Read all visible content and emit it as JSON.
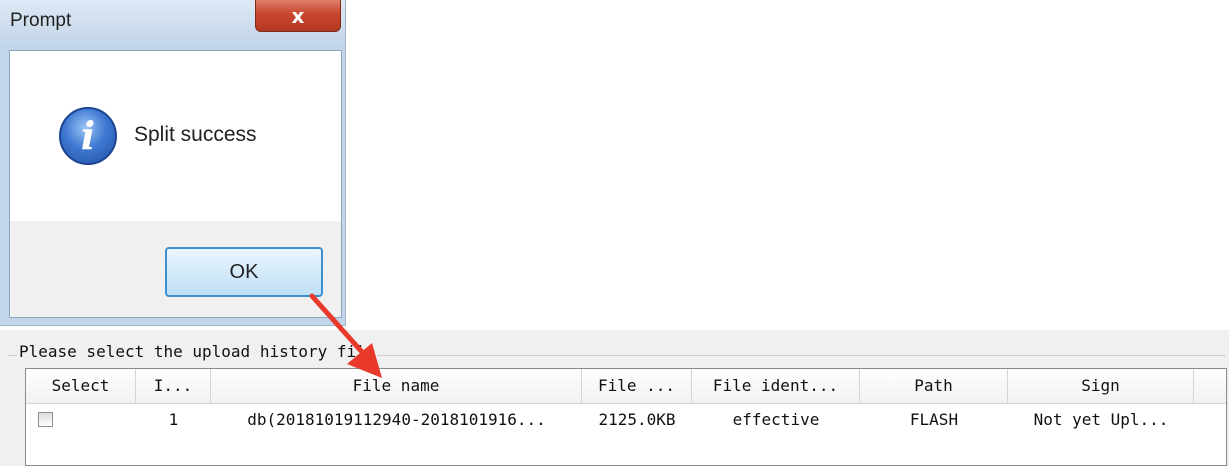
{
  "dialog": {
    "title": "Prompt",
    "close_label": "x",
    "message": "Split success",
    "info_icon_glyph": "i",
    "ok_label": "OK"
  },
  "panel": {
    "group_label": "Please select the upload history file",
    "columns": [
      "Select",
      "I...",
      "File name",
      "File ...",
      "File ident...",
      "Path",
      "Sign"
    ],
    "rows": [
      {
        "checked": false,
        "index": "1",
        "file_name": "db(20181019112940-2018101916...",
        "file_size": "2125.0KB",
        "file_ident": "effective",
        "path": "FLASH",
        "sign": "Not yet Upl..."
      }
    ]
  },
  "colors": {
    "arrow": "#e8392b",
    "ok_border": "#3c90d0",
    "dialog_frame": "#c3d5ea"
  }
}
